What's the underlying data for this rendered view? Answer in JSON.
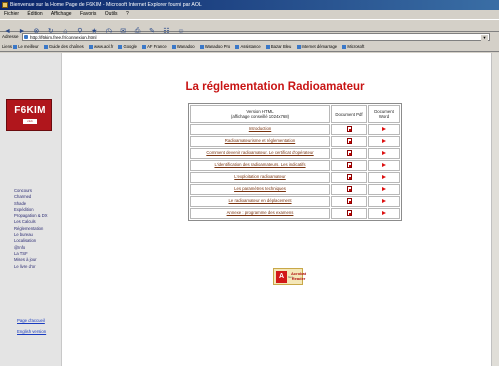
{
  "window": {
    "title": "Bienvenue sur la Home Page de F6KIM - Microsoft Internet Explorer fourni par AOL"
  },
  "menu": [
    "Fichier",
    "Édition",
    "Affichage",
    "Favoris",
    "Outils",
    "?"
  ],
  "address": {
    "label": "Adresse",
    "url": "http://f6kim.free.fr/connexion.html"
  },
  "links": [
    "Liens",
    "Le meilleur",
    "Guide des chaînes",
    "www.aol.fr",
    "Google",
    "AF France",
    "Wanadoo",
    "Wanadoo Pro",
    "Assistance",
    "Bazar Bleu",
    "Internet démarrage",
    "Microsoft"
  ],
  "sidebar": {
    "logo_text": "F6KIM",
    "logo_sub": "club",
    "nav": [
      "Concours",
      "Charmed",
      "Shade",
      "Expédition",
      "Propagation & DX",
      "Les Calculs",
      "Réglementation",
      "Le bureau",
      "Localisation",
      "@Info",
      "La TSF",
      "Mises à jour",
      "Le livre d'or"
    ],
    "links": [
      "Page d'accueil",
      "English version"
    ]
  },
  "page": {
    "heading": "La réglementation Radioamateur",
    "table": {
      "header": {
        "version": "Version HTML",
        "version_note": "(affichage conseillé 1024x768)",
        "pdf": "Document Pdf",
        "word": "Document Word"
      },
      "rows": [
        "Introduction",
        "Radioamateurisme et réglementation",
        "Comment devenir radioamateur. Le certificat d'opérateur",
        "L'identification des radioamateurs. Les indicatifs",
        "L'exploitation radioamateur",
        "Les paramètres techniques",
        "Le radioamateur en déplacement",
        "Annexe : programme des examens"
      ]
    },
    "acrobat": {
      "get": "Get",
      "name": "Acrobat Reader"
    }
  },
  "colors": {
    "heading": "#c81414",
    "link": "#7a3410",
    "titlebar": "#0a246a"
  }
}
